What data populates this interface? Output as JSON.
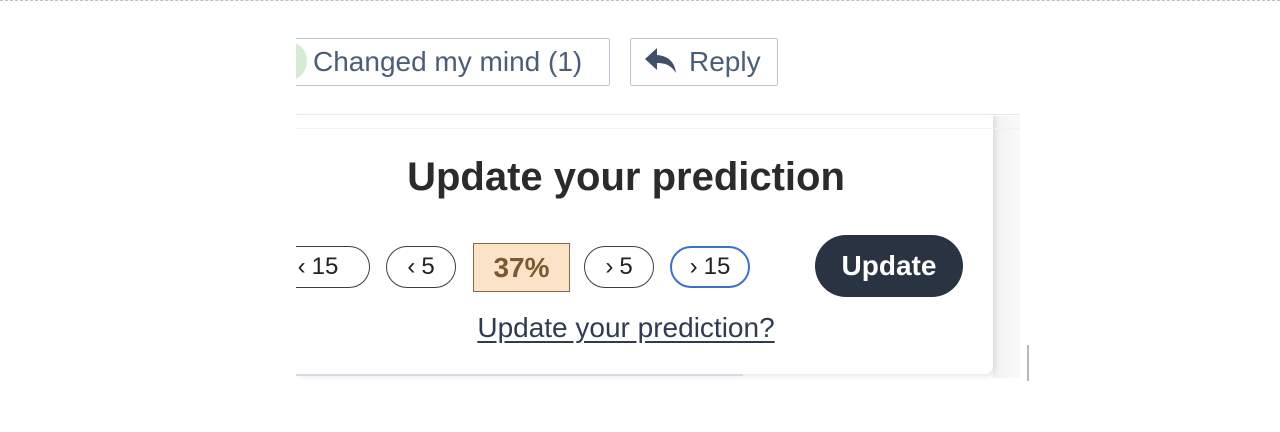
{
  "toolbar": {
    "changed_label": "Changed my mind (1)",
    "reply_label": "Reply",
    "reply_icon": "reply-arrow-icon",
    "changed_icon": "changed-mind-icon"
  },
  "card": {
    "title": "Update your prediction",
    "decrease_15_label": "15",
    "decrease_5_label": "5",
    "current_value": "37%",
    "increase_5_label": "5",
    "increase_15_label": "15",
    "update_button": "Update",
    "update_link": "Update your prediction?"
  },
  "colors": {
    "accent_dark": "#293341",
    "value_bg": "#fbe3c7",
    "focus_ring": "#3d6fd0"
  }
}
